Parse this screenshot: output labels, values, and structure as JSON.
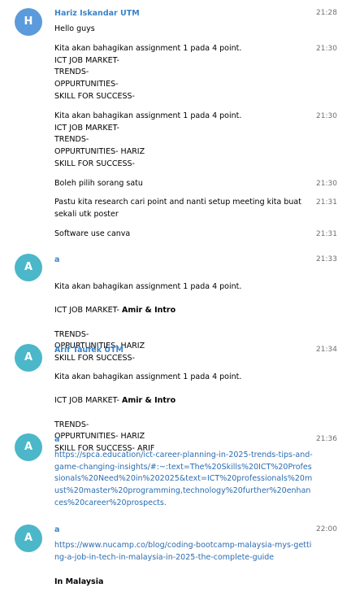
{
  "colors": {
    "avatar_blue": "#5b9bdc",
    "avatar_teal": "#4bb7c9",
    "sender_name": "#3a84c8",
    "link": "#2a6cb0",
    "time": "#6f6f6f"
  },
  "messages": [
    {
      "sender": "Hariz Iskandar UTM",
      "initial": "H",
      "time": "21:28",
      "text": "Hello guys"
    },
    {
      "time": "21:30",
      "text": "Kita akan bahagikan assignment 1 pada 4 point.\nICT JOB MARKET-\nTRENDS-\nOPPURTUNITIES-\nSKILL FOR SUCCESS-"
    },
    {
      "time": "21:30",
      "text": "Kita akan bahagikan assignment 1 pada 4 point.\nICT JOB MARKET-\nTRENDS-\nOPPURTUNITIES- HARIZ\nSKILL FOR SUCCESS-"
    },
    {
      "time": "21:30",
      "text": "Boleh pilih sorang satu"
    },
    {
      "time": "21:31",
      "text": "Pastu kita research cari point and nanti setup meeting kita buat sekali utk poster"
    },
    {
      "time": "21:31",
      "text": "Software use canva"
    },
    {
      "sender": "a",
      "initial": "A",
      "time": "21:33",
      "line1": "Kita akan bahagikan assignment 1 pada 4 point.",
      "line2_prefix": "ICT JOB MARKET- ",
      "line2_bold": "Amir & Intro",
      "rest": "TRENDS-\nOPPURTUNITIES- HARIZ\nSKILL FOR SUCCESS-"
    },
    {
      "sender": "Arif Taufek UTM",
      "initial": "A",
      "time": "21:34",
      "line1": "Kita akan bahagikan assignment 1 pada 4 point.",
      "line2_prefix": "ICT JOB MARKET- ",
      "line2_bold": "Amir & Intro",
      "rest": "TRENDS-\nOPPURTUNITIES- HARIZ\nSKILL FOR SUCCESS- ARIF"
    },
    {
      "sender": "a",
      "initial": "A",
      "time": "21:36",
      "link": "https://spca.education/ict-career-planning-in-2025-trends-tips-and-game-changing-insights/#:~:text=The%20Skills%20ICT%20Professionals%20Need%20in%202025&text=ICT%20professionals%20must%20master%20programming,technology%20further%20enhances%20career%20prospects."
    },
    {
      "sender": "a",
      "initial": "A",
      "time": "22:00",
      "link": "https://www.nucamp.co/blog/coding-bootcamp-malaysia-mys-getting-a-job-in-tech-in-malaysia-in-2025-the-complete-guide",
      "bold_text": "In Malaysia"
    }
  ]
}
